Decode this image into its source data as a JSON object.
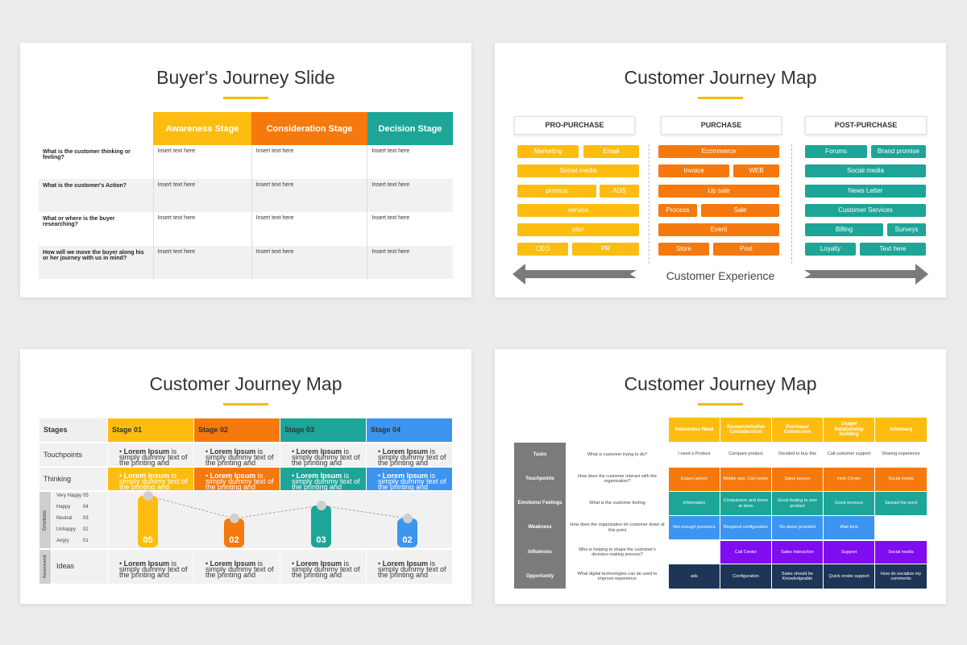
{
  "slide1": {
    "title": "Buyer's Journey Slide",
    "headers": [
      "Awareness Stage",
      "Consideration Stage",
      "Decision Stage"
    ],
    "header_colors": [
      "#fdbd10",
      "#f5790d",
      "#1da597"
    ],
    "rows": [
      {
        "q": "What is the customer thinking or feeling?",
        "cells": [
          "Insert text here",
          "Insert text here",
          "Insert text here"
        ]
      },
      {
        "q": "What is the customer's Action?",
        "cells": [
          "Insert text here",
          "Insert text here",
          "Insert text here"
        ]
      },
      {
        "q": "What or where is the buyer researching?",
        "cells": [
          "Insert text here",
          "Insert text here",
          "Insert text here"
        ]
      },
      {
        "q": "How will we move the buyer along his or her journey with us in mind?",
        "cells": [
          "Insert text here",
          "Insert text here",
          "Insert text here"
        ]
      }
    ]
  },
  "slide2": {
    "title": "Customer Journey Map",
    "phases": [
      "PRO-PURCHASE",
      "PURCHASE",
      "POST-PURCHASE"
    ],
    "pre": [
      "Marketing",
      "Email",
      "Social media",
      "promos",
      "ADS",
      "service",
      "plan",
      "CEO",
      "PR"
    ],
    "purchase": [
      "Ecommerce",
      "Invoice",
      "WEB",
      "Up sale",
      "Process",
      "Sale",
      "Event",
      "Store",
      "Post"
    ],
    "post": [
      "Forums",
      "Brand promise",
      "Social media",
      "News Letter",
      "Customer Services",
      "Billing",
      "Surveys",
      "Loyalty",
      "Text here"
    ],
    "footer": "Customer Experience"
  },
  "slide3": {
    "title": "Customer Journey Map",
    "stages_label": "Stages",
    "stages": [
      "Stage 01",
      "Stage 02",
      "Stage 03",
      "Stage 04"
    ],
    "stage_colors": [
      "#fdbd10",
      "#f5790d",
      "#1da597",
      "#3d95ef"
    ],
    "touchpoints_label": "Touchpoints",
    "thinking_label": "Thinking",
    "ideas_label": "Ideas",
    "emotions_label": "Emotions",
    "recommend_label": "Recommend",
    "lorem_bold": "Lorem Ipsum",
    "lorem_rest": " is simply dummy text of the printing and",
    "emotion_levels": [
      {
        "name": "Very Happy",
        "value": "05"
      },
      {
        "name": "Happy",
        "value": "04"
      },
      {
        "name": "Neutral",
        "value": "03"
      },
      {
        "name": "Unhappy",
        "value": "02"
      },
      {
        "name": "Angry",
        "value": "01"
      }
    ],
    "pins": [
      "05",
      "02",
      "03",
      "02"
    ]
  },
  "slide4": {
    "title": "Customer Journey Map",
    "headers": [
      "Awareness Need",
      "Research/Active Consideration",
      "Purchase/ Conversion",
      "Usage/ Relationship Building",
      "Advocacy"
    ],
    "rows": [
      {
        "label": "Tasks",
        "q": "What is customer trying to do?",
        "cells": [
          "I need a Product",
          "Compare product",
          "Decided to buy this",
          "Call customer support",
          "Sharing experience"
        ]
      },
      {
        "label": "Touchpoints",
        "q": "How does the customer interact with the organization?",
        "cells": [
          "Expert advice",
          "Mobile app, Call center",
          "Sales person",
          "Help Center",
          "Social media"
        ]
      },
      {
        "label": "Emotions/ Feelings",
        "q": "What is the customer feeling",
        "cells": [
          "Information",
          "Comparison and demo at store",
          "Great feeling to own product",
          "Good services",
          "Spread the word"
        ]
      },
      {
        "label": "Weakness",
        "q": "How does the organization let customer down at this point",
        "cells": [
          "Not enough presence",
          "Required configuration",
          "No demo provided",
          "Wait time",
          ""
        ]
      },
      {
        "label": "Influences",
        "q": "Who is helping to shape the customer's decision-making process?",
        "cells": [
          "",
          "Call Center",
          "Sales interaction",
          "Support",
          "Social media"
        ]
      },
      {
        "label": "Opportunity",
        "q": "What digital technologies can de used to improve experience",
        "cells": [
          "ads",
          "Configuration",
          "Sales should be Knowledgeable",
          "Quick onsite support",
          "How do socialize my comments"
        ]
      }
    ]
  }
}
